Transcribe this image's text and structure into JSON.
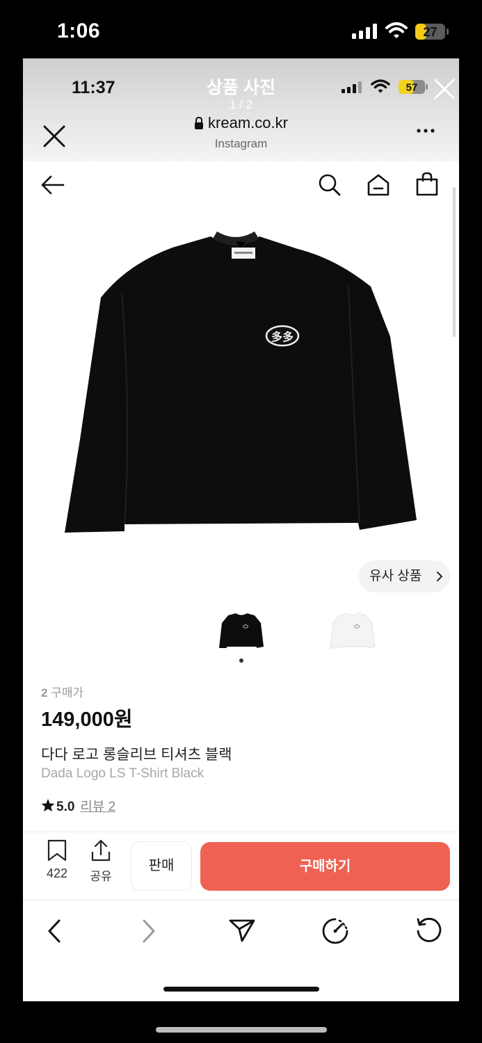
{
  "outer_status": {
    "time": "1:06",
    "battery": "27"
  },
  "inner_status": {
    "time": "11:37",
    "battery": "57"
  },
  "viewer": {
    "title": "상품 사진",
    "counter": "1 / 2"
  },
  "browser": {
    "domain": "kream.co.kr",
    "source": "Instagram"
  },
  "product": {
    "similar_label": "유사 상품",
    "buyers_count": "2",
    "buyers_label": "구매가",
    "price": "149,000원",
    "name_ko": "다다 로고 롱슬리브 티셔츠 블랙",
    "name_en": "Dada Logo LS T-Shirt Black",
    "rating": "5.0",
    "review_link": "리뷰 2",
    "logo_text": "多多",
    "colors": [
      "black",
      "white"
    ]
  },
  "actions": {
    "wish_count": "422",
    "share_label": "공유",
    "sell_label": "판매",
    "buy_label": "구매하기"
  },
  "colors": {
    "buy_button": "#ef6253",
    "header_overlay": "#d6d6d6"
  },
  "icons": [
    "back-arrow-icon",
    "search-icon",
    "home-icon",
    "shopping-bag-icon",
    "bookmark-icon",
    "share-icon",
    "lock-icon",
    "more-icon",
    "close-icon",
    "chevron-left-icon",
    "chevron-right-icon",
    "send-icon",
    "speed-icon",
    "reload-icon",
    "star-icon"
  ]
}
